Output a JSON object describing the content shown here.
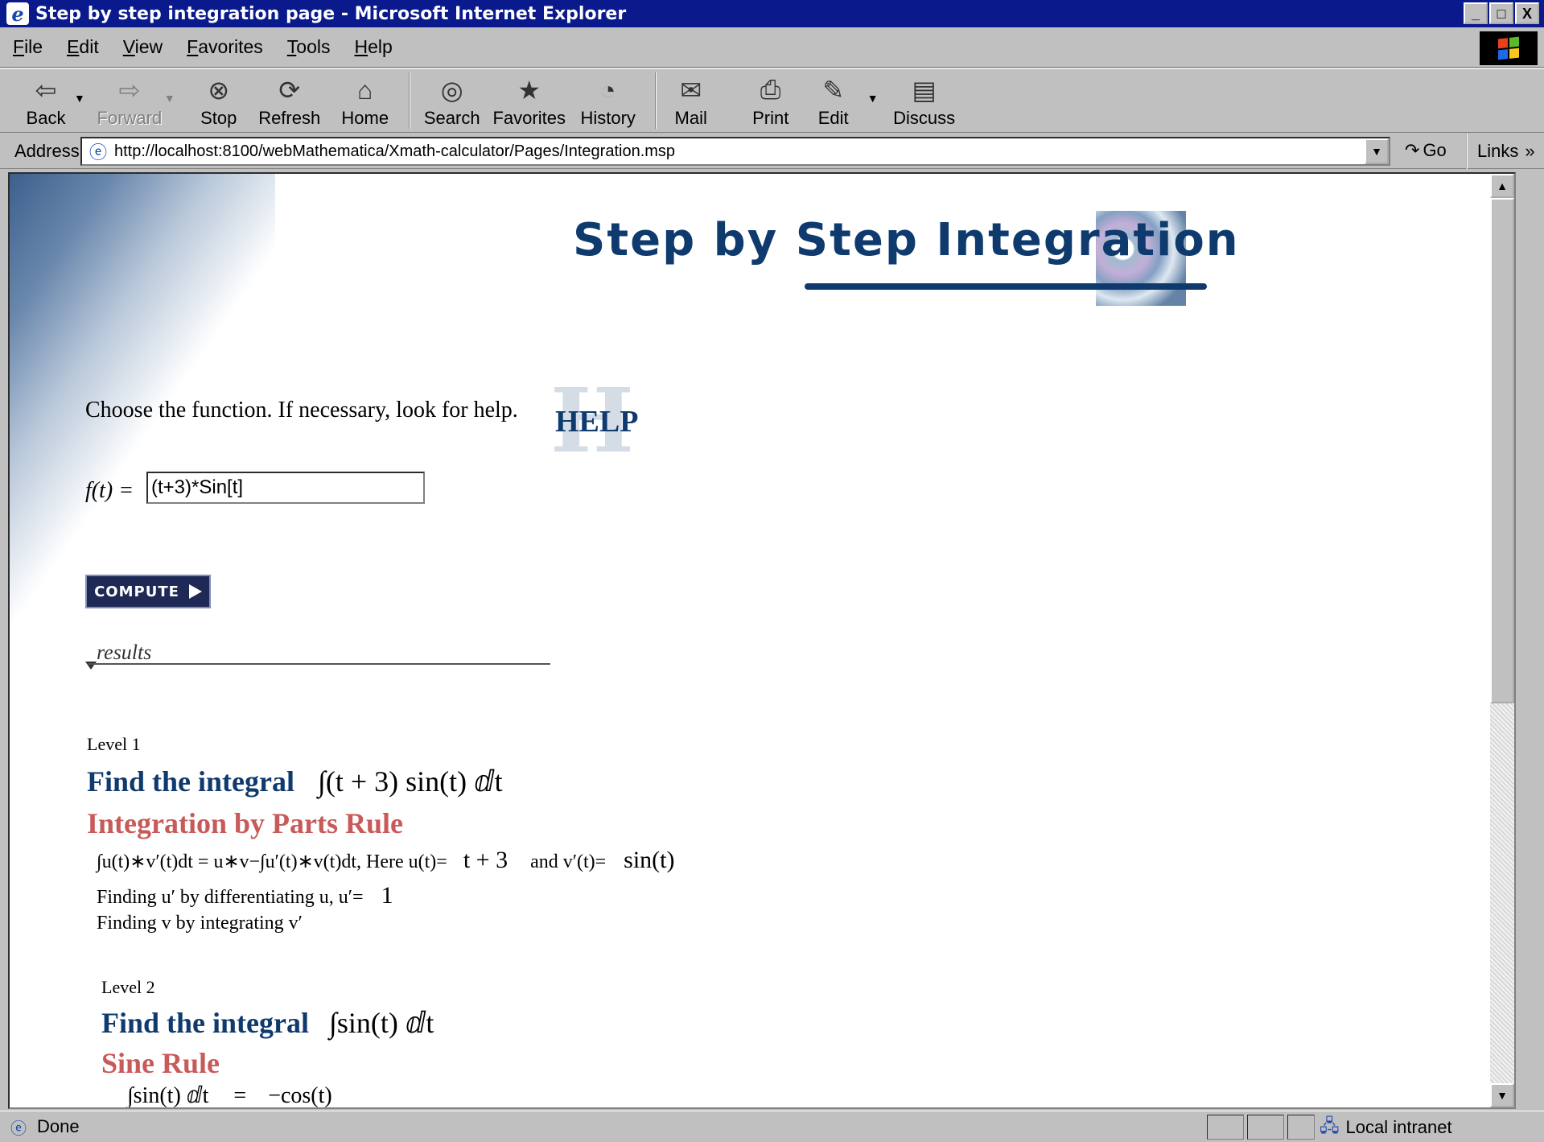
{
  "window": {
    "title": "Step by step integration page - Microsoft Internet Explorer",
    "controls": [
      "_",
      "□",
      "X"
    ]
  },
  "menu": [
    "File",
    "Edit",
    "View",
    "Favorites",
    "Tools",
    "Help"
  ],
  "toolbar": {
    "back": "Back",
    "forward": "Forward",
    "stop": "Stop",
    "refresh": "Refresh",
    "home": "Home",
    "search": "Search",
    "favorites": "Favorites",
    "history": "History",
    "mail": "Mail",
    "print": "Print",
    "edit": "Edit",
    "discuss": "Discuss"
  },
  "address": {
    "label": "Address",
    "url": "http://localhost:8100/webMathematica/Xmath-calculator/Pages/Integration.msp",
    "go": "Go",
    "links": "Links"
  },
  "page": {
    "banner_title": "Step by Step Integration",
    "prompt": "Choose the function. If necessary, look for help.",
    "help_label": "HELP",
    "function_label": "f(t) =",
    "function_value": "(t+3)*Sin[t]",
    "compute_label": "COMPUTE",
    "results_label": "results"
  },
  "results": {
    "level1": {
      "level": "Level 1",
      "heading": "Find the integral",
      "integral": "∫(t + 3) sin(t) ⅆt",
      "rule": "Integration by Parts Rule",
      "parts_formula": "∫u(t)∗v′(t)dt = u∗v−∫u′(t)∗v(t)dt, Here u(t)=",
      "u_value": "t + 3",
      "and_text": "and  v′(t)=",
      "v_value": "sin(t)",
      "diff_text": "Finding u′ by differentiating u, u′=",
      "du_value": "1",
      "integ_text": "Finding v by integrating v′"
    },
    "level2": {
      "level": "Level 2",
      "heading": "Find the integral",
      "integral": "∫sin(t) ⅆt",
      "rule": "Sine Rule",
      "result_lhs": "∫sin(t) ⅆt",
      "equals": "=",
      "result_rhs": "−cos(t)"
    }
  },
  "status": {
    "text": "Done",
    "zone": "Local intranet"
  }
}
